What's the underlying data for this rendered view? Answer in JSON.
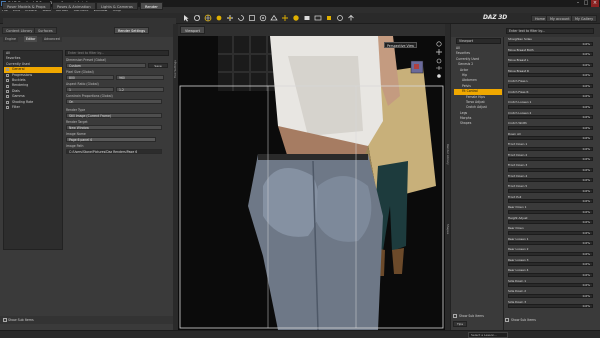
{
  "window": {
    "title": "DAZ Studio 4.7 Pro - Page 6 panel 4.duf"
  },
  "menu": [
    "File",
    "Edit",
    "Create",
    "Tools",
    "Render",
    "Connect",
    "Window",
    "Help"
  ],
  "pane_tabs": [
    "Poser Models & Props",
    "Poses & Animation",
    "Lights & Cameras",
    "Render"
  ],
  "brand": "DAZ 3D",
  "header_buttons": [
    "Home",
    "My account",
    "My Gallery"
  ],
  "left_panel": {
    "tabs": [
      "Content Library",
      "Surfaces",
      "Render Settings"
    ],
    "subtabs": [
      "Engine",
      "Editor",
      "Advanced"
    ],
    "categories": [
      {
        "label": "All",
        "selected": false,
        "child": false
      },
      {
        "label": "Favorites",
        "selected": false,
        "child": false
      },
      {
        "label": "Currently Used",
        "selected": false,
        "child": false
      },
      {
        "label": "General",
        "selected": true,
        "child": true
      },
      {
        "label": "Progressions",
        "selected": false,
        "child": true
      },
      {
        "label": "Bucklets",
        "selected": false,
        "child": true
      },
      {
        "label": "Rendering",
        "selected": false,
        "child": true
      },
      {
        "label": "Dials",
        "selected": false,
        "child": true
      },
      {
        "label": "Gamma",
        "selected": false,
        "child": true
      },
      {
        "label": "Shading Rate",
        "selected": false,
        "child": true
      },
      {
        "label": "Filter",
        "selected": false,
        "child": true
      }
    ],
    "search_placeholder": "Enter text to filter by...",
    "properties": [
      {
        "label": "Dimension Preset (Global)",
        "value": "Custom",
        "button": "Save"
      },
      {
        "label": "Pixel Size (Global)",
        "value": "800",
        "value2": "960"
      },
      {
        "label": "Aspect Ratio (Global)",
        "value": "1",
        "value2": "1.2"
      },
      {
        "label": "Constrain Proportions (Global)",
        "value": "On"
      },
      {
        "label": "Render Type",
        "value": "Still Image (Current Frame)"
      },
      {
        "label": "Render Target",
        "value": "New Window"
      },
      {
        "label": "Image Name",
        "value": "Page 6 panel 4"
      },
      {
        "label": "Image Path",
        "value": "C:/Users/Stone/Pictures/Daz Renders/Page 6"
      }
    ],
    "footer_toggle": "Show Sub Items"
  },
  "viewport": {
    "tab": "Viewport",
    "camera": "Perspective View"
  },
  "side_tabs": [
    "Tool Settings",
    "Render Library",
    "Shapes"
  ],
  "scene_panel": {
    "dropdown": "Viewport",
    "items": [
      {
        "label": "All",
        "sel": false
      },
      {
        "label": "Favorites",
        "sel": false
      },
      {
        "label": "Currently Used",
        "sel": false
      },
      {
        "label": "Genesis 2",
        "sel": false
      },
      {
        "label": "Actor",
        "sel": false
      },
      {
        "label": "Hip",
        "sel": false
      },
      {
        "label": "Abdomen",
        "sel": false
      },
      {
        "label": "Pelvis",
        "sel": false
      },
      {
        "label": "Fit Control",
        "sel": true
      },
      {
        "label": "Female Hips",
        "sel": false
      },
      {
        "label": "Torso Adjust",
        "sel": false
      },
      {
        "label": "Crotch Adjust",
        "sel": false
      },
      {
        "label": "Legs",
        "sel": false
      },
      {
        "label": "Morphs",
        "sel": false
      },
      {
        "label": "Shapes",
        "sel": false
      }
    ],
    "footer_toggle": "Show Sub Items",
    "footer_button": "Tips"
  },
  "shapes_panel": {
    "search_placeholder": "Enter text to filter by...",
    "rows": [
      {
        "label": "Straighten Sides",
        "value": "0.0%",
        "fill": 0.0
      },
      {
        "label": "Move Breast Both",
        "value": "0.0%",
        "fill": 0.0
      },
      {
        "label": "Move Breast L",
        "value": "0.0%",
        "fill": 0.0
      },
      {
        "label": "Move Breast R",
        "value": "0.0%",
        "fill": 0.0
      },
      {
        "label": "Crotch Fixes L",
        "value": "0.0%",
        "fill": 0.0
      },
      {
        "label": "Crotch Fixes R",
        "value": "0.0%",
        "fill": 0.0
      },
      {
        "label": "Crotch Loosen 1",
        "value": "0.0%",
        "fill": 0.0
      },
      {
        "label": "Crotch Loosen 2",
        "value": "0.0%",
        "fill": 0.0
      },
      {
        "label": "Crotch Width",
        "value": "0.0%",
        "fill": 0.0
      },
      {
        "label": "Down All",
        "value": "0.0%",
        "fill": 0.0
      },
      {
        "label": "Front Down 1",
        "value": "0.0%",
        "fill": 0.0
      },
      {
        "label": "Front Down 2",
        "value": "0.0%",
        "fill": 0.0
      },
      {
        "label": "Front Down 3",
        "value": "0.0%",
        "fill": 0.0
      },
      {
        "label": "Front Down 4",
        "value": "0.0%",
        "fill": 0.0
      },
      {
        "label": "Front Down 5",
        "value": "0.0%",
        "fill": 0.0
      },
      {
        "label": "Front Pull",
        "value": "0.0%",
        "fill": 0.0
      },
      {
        "label": "Rear Down 1",
        "value": "0.0%",
        "fill": 0.0
      },
      {
        "label": "Height Adjust",
        "value": "0.0%",
        "fill": 0.0
      },
      {
        "label": "Rear Down",
        "value": "0.0%",
        "fill": 0.0
      },
      {
        "label": "Rear Loosen 1",
        "value": "0.0%",
        "fill": 0.0
      },
      {
        "label": "Rear Loosen 2",
        "value": "0.0%",
        "fill": 0.0
      },
      {
        "label": "Rear Loosen 3",
        "value": "0.0%",
        "fill": 0.0
      },
      {
        "label": "Rear Loosen 4",
        "value": "0.0%",
        "fill": 0.0
      },
      {
        "label": "Side Down 1",
        "value": "0.0%",
        "fill": 0.0
      },
      {
        "label": "Side Down 2",
        "value": "0.0%",
        "fill": 0.0
      },
      {
        "label": "Side Down 3",
        "value": "0.0%",
        "fill": 0.0
      }
    ],
    "footer_toggle": "Show Sub Items"
  },
  "status": {
    "dropdown": "Select a Lesson..."
  }
}
